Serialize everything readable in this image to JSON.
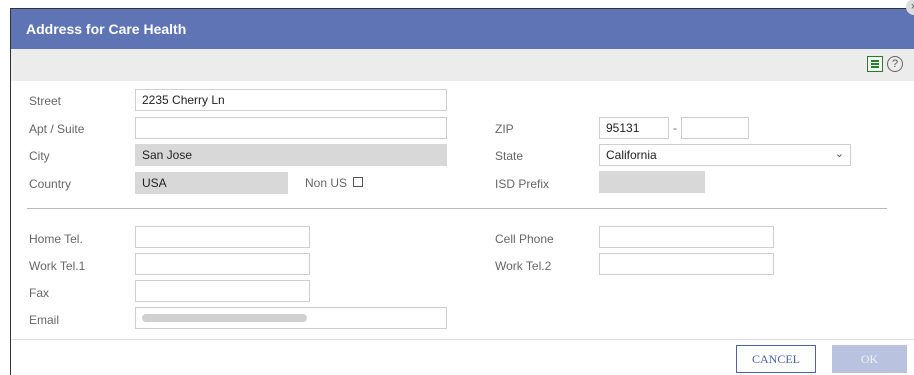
{
  "dialog": {
    "title": "Address for Care Health",
    "close_glyph": "×"
  },
  "toolbar": {
    "help_glyph": "?"
  },
  "fields": {
    "street": {
      "label": "Street",
      "value": "2235 Cherry Ln"
    },
    "apt": {
      "label": "Apt / Suite",
      "value": ""
    },
    "city": {
      "label": "City",
      "value": "San Jose"
    },
    "country": {
      "label": "Country",
      "value": "USA"
    },
    "non_us": {
      "label": "Non US",
      "checked": false
    },
    "zip": {
      "label": "ZIP",
      "value": "95131",
      "ext": "",
      "sep": "-"
    },
    "state": {
      "label": "State",
      "value": "California"
    },
    "isd_prefix": {
      "label": "ISD Prefix",
      "value": ""
    },
    "home_tel": {
      "label": "Home Tel.",
      "value": ""
    },
    "work_tel1": {
      "label": "Work Tel.1",
      "value": ""
    },
    "fax": {
      "label": "Fax",
      "value": ""
    },
    "email": {
      "label": "Email",
      "value": ""
    },
    "cell_phone": {
      "label": "Cell Phone",
      "value": ""
    },
    "work_tel2": {
      "label": "Work Tel.2",
      "value": ""
    }
  },
  "buttons": {
    "cancel": "CANCEL",
    "ok": "OK"
  },
  "colors": {
    "header": "#5e74b5",
    "accent": "#4d62a8",
    "readonly": "#d8d8d8"
  }
}
